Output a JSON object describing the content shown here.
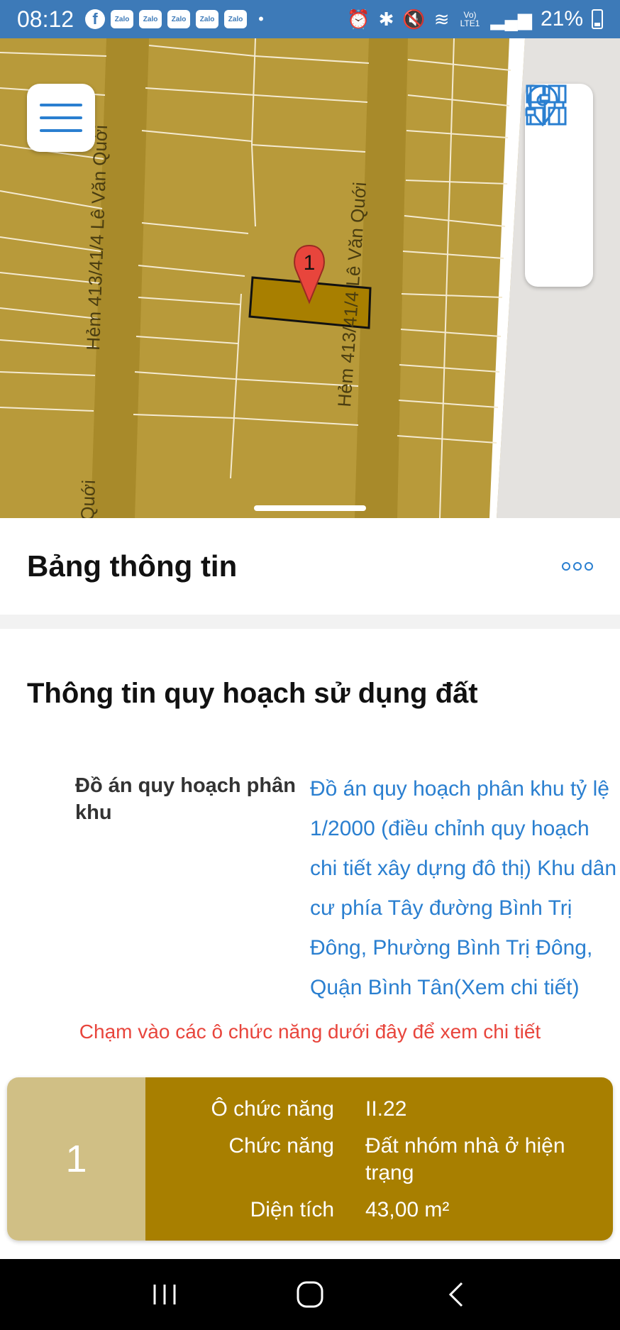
{
  "status_bar": {
    "time": "08:12",
    "notification_icons": [
      "facebook-icon",
      "zalo-icon",
      "zalo-icon",
      "zalo-icon",
      "zalo-icon",
      "zalo-icon"
    ],
    "zalo_label": "Zalo",
    "fb_label": "f",
    "more_dot": "•",
    "signal_label": "Vo) LTE1",
    "battery": "21%"
  },
  "map": {
    "street_labels": [
      "Hẻm 413/41/4 Lê Văn Quới",
      "Hẻm 413/41/4 Lê Văn Quới",
      "Quới"
    ],
    "marker_label": "1",
    "colors": {
      "land": "#b89a3a",
      "road": "#a88a2a",
      "selected": "#a87f00",
      "marker": "#e8453c"
    }
  },
  "info_panel": {
    "title": "Bảng thông tin",
    "section_title": "Thông tin quy hoạch sử dụng đất",
    "plan_label": "Đồ án quy hoạch phân khu",
    "plan_value": "Đồ án quy hoạch phân khu tỷ lệ 1/2000 (điều chỉnh quy hoạch chi tiết xây dựng đô thị) Khu dân cư phía Tây đường Bình Trị Đông, Phường Bình Trị Đông, Quận Bình Tân(Xem chi tiết)",
    "hint": "Chạm vào các ô chức năng dưới đây để xem chi tiết"
  },
  "lot_card": {
    "number": "1",
    "rows": [
      {
        "label": "Ô chức năng",
        "value": "II.22"
      },
      {
        "label": "Chức năng",
        "value": "Đất nhóm nhà ở hiện trạng"
      },
      {
        "label": "Diện tích",
        "value": "43,00 m²"
      }
    ],
    "colors": {
      "left": "#d0bf85",
      "right": "#a87f00"
    }
  }
}
